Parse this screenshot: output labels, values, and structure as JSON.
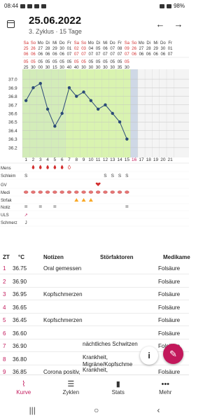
{
  "status": {
    "time": "08:44",
    "battery": "98%"
  },
  "header": {
    "date": "25.06.2022",
    "subtitle": "3. Zyklus · 15 Tage"
  },
  "days": [
    {
      "wd": "Sa",
      "d": "25",
      "m": "06",
      "n": "05",
      "n2": "25"
    },
    {
      "wd": "So",
      "d": "26",
      "m": "06",
      "n": "05",
      "n2": "30"
    },
    {
      "wd": "Mo",
      "d": "27",
      "m": "06",
      "n": "05",
      "n2": "00"
    },
    {
      "wd": "Di",
      "d": "28",
      "m": "06",
      "n": "05",
      "n2": "30"
    },
    {
      "wd": "Mi",
      "d": "29",
      "m": "06",
      "n": "05",
      "n2": "15"
    },
    {
      "wd": "Do",
      "d": "30",
      "m": "06",
      "n": "05",
      "n2": "30"
    },
    {
      "wd": "Fr",
      "d": "01",
      "m": "07",
      "n": "05",
      "n2": "40"
    },
    {
      "wd": "Sa",
      "d": "02",
      "m": "07",
      "n": "05",
      "n2": "40"
    },
    {
      "wd": "So",
      "d": "03",
      "m": "07",
      "n": "05",
      "n2": "30"
    },
    {
      "wd": "Mo",
      "d": "04",
      "m": "07",
      "n": "05",
      "n2": "30"
    },
    {
      "wd": "Di",
      "d": "05",
      "m": "07",
      "n": "05",
      "n2": "30"
    },
    {
      "wd": "Mi",
      "d": "06",
      "m": "07",
      "n": "05",
      "n2": "30"
    },
    {
      "wd": "Do",
      "d": "07",
      "m": "07",
      "n": "05",
      "n2": "30"
    },
    {
      "wd": "Fr",
      "d": "08",
      "m": "07",
      "n": "05",
      "n2": "35"
    },
    {
      "wd": "Sa",
      "d": "09",
      "m": "07",
      "n": "05",
      "n2": "30"
    },
    {
      "wd": "So",
      "d": "26",
      "m": "06",
      "n": "",
      "n2": ""
    },
    {
      "wd": "Mo",
      "d": "27",
      "m": "06",
      "n": "",
      "n2": ""
    },
    {
      "wd": "Di",
      "d": "28",
      "m": "06",
      "n": "",
      "n2": ""
    },
    {
      "wd": "Mi",
      "d": "29",
      "m": "06",
      "n": "",
      "n2": ""
    },
    {
      "wd": "Do",
      "d": "30",
      "m": "06",
      "n": "",
      "n2": ""
    },
    {
      "wd": "Fr",
      "d": "01",
      "m": "07",
      "n": "",
      "n2": ""
    }
  ],
  "chart_data": {
    "type": "line",
    "ylabels": [
      "37.0",
      "36.9",
      "36.8",
      "36.7",
      "36.6",
      "36.5",
      "36.4",
      "36.3",
      "36.2"
    ],
    "ylim": [
      36.15,
      37.05
    ],
    "temps": [
      36.75,
      36.9,
      36.95,
      36.65,
      36.45,
      36.6,
      36.9,
      36.8,
      36.85,
      36.75,
      36.65,
      36.7,
      36.6,
      36.5,
      36.3
    ],
    "cycle_days": [
      "1",
      "2",
      "3",
      "4",
      "5",
      "6",
      "7",
      "8",
      "9",
      "10",
      "11",
      "12",
      "13",
      "14",
      "15",
      "16",
      "17",
      "18",
      "19",
      "20",
      "21"
    ],
    "colors": {
      "low_phase": "#cfe8c0",
      "high_phase": "#d9f3b0",
      "line": "#2b4a78",
      "weekend": "#d32f2f"
    }
  },
  "rows_labels": [
    "Mens",
    "Schleim",
    "GV",
    "Medi",
    "Strfak",
    "Notiz",
    "ULS",
    "Schmerz"
  ],
  "schleim": [
    "S",
    "",
    "",
    "",
    "",
    "",
    "",
    "",
    "",
    "",
    "",
    "S",
    "S",
    "S",
    "S"
  ],
  "table": {
    "headers": {
      "zt": "ZT",
      "temp": "°C",
      "notes": "Notizen",
      "factors": "Störfaktoren",
      "meds": "Medikame"
    },
    "rows": [
      {
        "zt": "1",
        "temp": "36.75",
        "note": "Oral gemessen",
        "factor": "",
        "med": "Folsäure"
      },
      {
        "zt": "2",
        "temp": "36.90",
        "note": "",
        "factor": "",
        "med": "Folsäure"
      },
      {
        "zt": "3",
        "temp": "36.95",
        "note": "Kopfschmerzen",
        "factor": "",
        "med": "Folsäure"
      },
      {
        "zt": "4",
        "temp": "36.65",
        "note": "",
        "factor": "",
        "med": "Folsäure"
      },
      {
        "zt": "5",
        "temp": "36.45",
        "note": "Kopfschmerzen",
        "factor": "",
        "med": "Folsäure"
      },
      {
        "zt": "6",
        "temp": "36.60",
        "note": "",
        "factor": "",
        "med": "Folsäure"
      },
      {
        "zt": "7",
        "temp": "36.90",
        "note": "",
        "factor": "nächtliches Schwitzen",
        "med": "Folsäure"
      },
      {
        "zt": "8",
        "temp": "36.80",
        "note": "",
        "factor": "Krankheit, Migräne/Kopfschme",
        "med": ""
      },
      {
        "zt": "9",
        "temp": "36.85",
        "note": "Corona positiv,",
        "factor": "Krankheit,",
        "med": "Folsäure"
      }
    ]
  },
  "nav": [
    {
      "label": "Kurve",
      "icon": "⌇"
    },
    {
      "label": "Zyklen",
      "icon": "☰"
    },
    {
      "label": "Stats",
      "icon": "▮"
    },
    {
      "label": "Mehr",
      "icon": "•••"
    }
  ],
  "fab": {
    "info": "i",
    "edit": "✎"
  },
  "sysnav": [
    "|||",
    "○",
    "‹"
  ]
}
